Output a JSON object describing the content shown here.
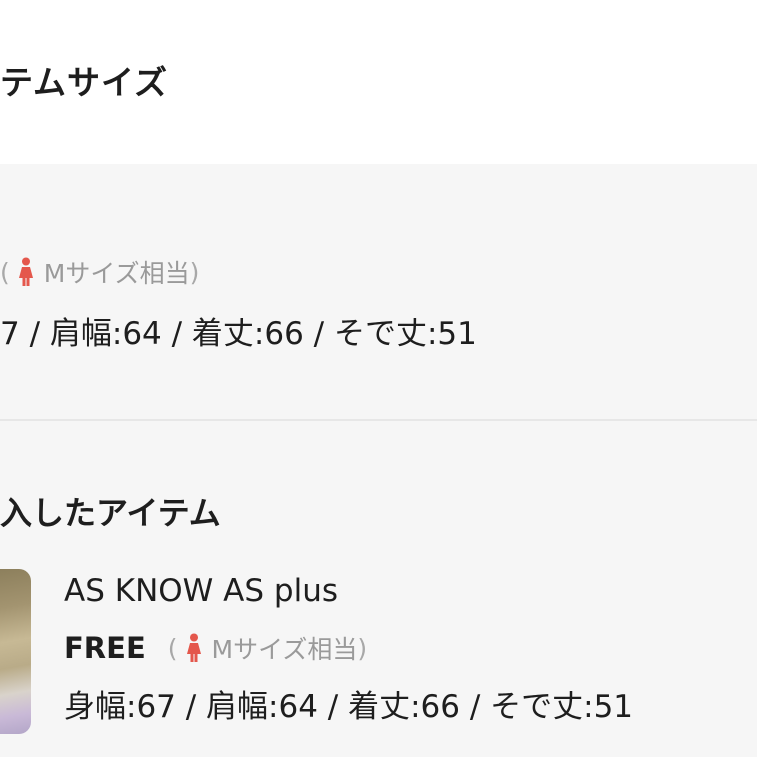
{
  "section_size": {
    "title": "テムサイズ",
    "note_open": "(",
    "note_label": "Mサイズ相当",
    "note_close": ")",
    "measurements": "7 / 肩幅:64 / 着丈:66 / そで丈:51"
  },
  "section_items": {
    "title": "入したアイテム",
    "item": {
      "brand": "AS KNOW AS plus",
      "size": "FREE",
      "note_open": "(",
      "note_label": "Mサイズ相当",
      "note_close": ")",
      "measurements": "身幅:67 / 肩幅:64 / 着丈:66 / そで丈:51"
    }
  },
  "colors": {
    "woman_icon": "#e4574c",
    "background": "#f6f6f6",
    "text": "#1e1e1e",
    "muted_text": "#9a9a9a"
  },
  "icons": {
    "size_indicator": "woman-icon"
  }
}
